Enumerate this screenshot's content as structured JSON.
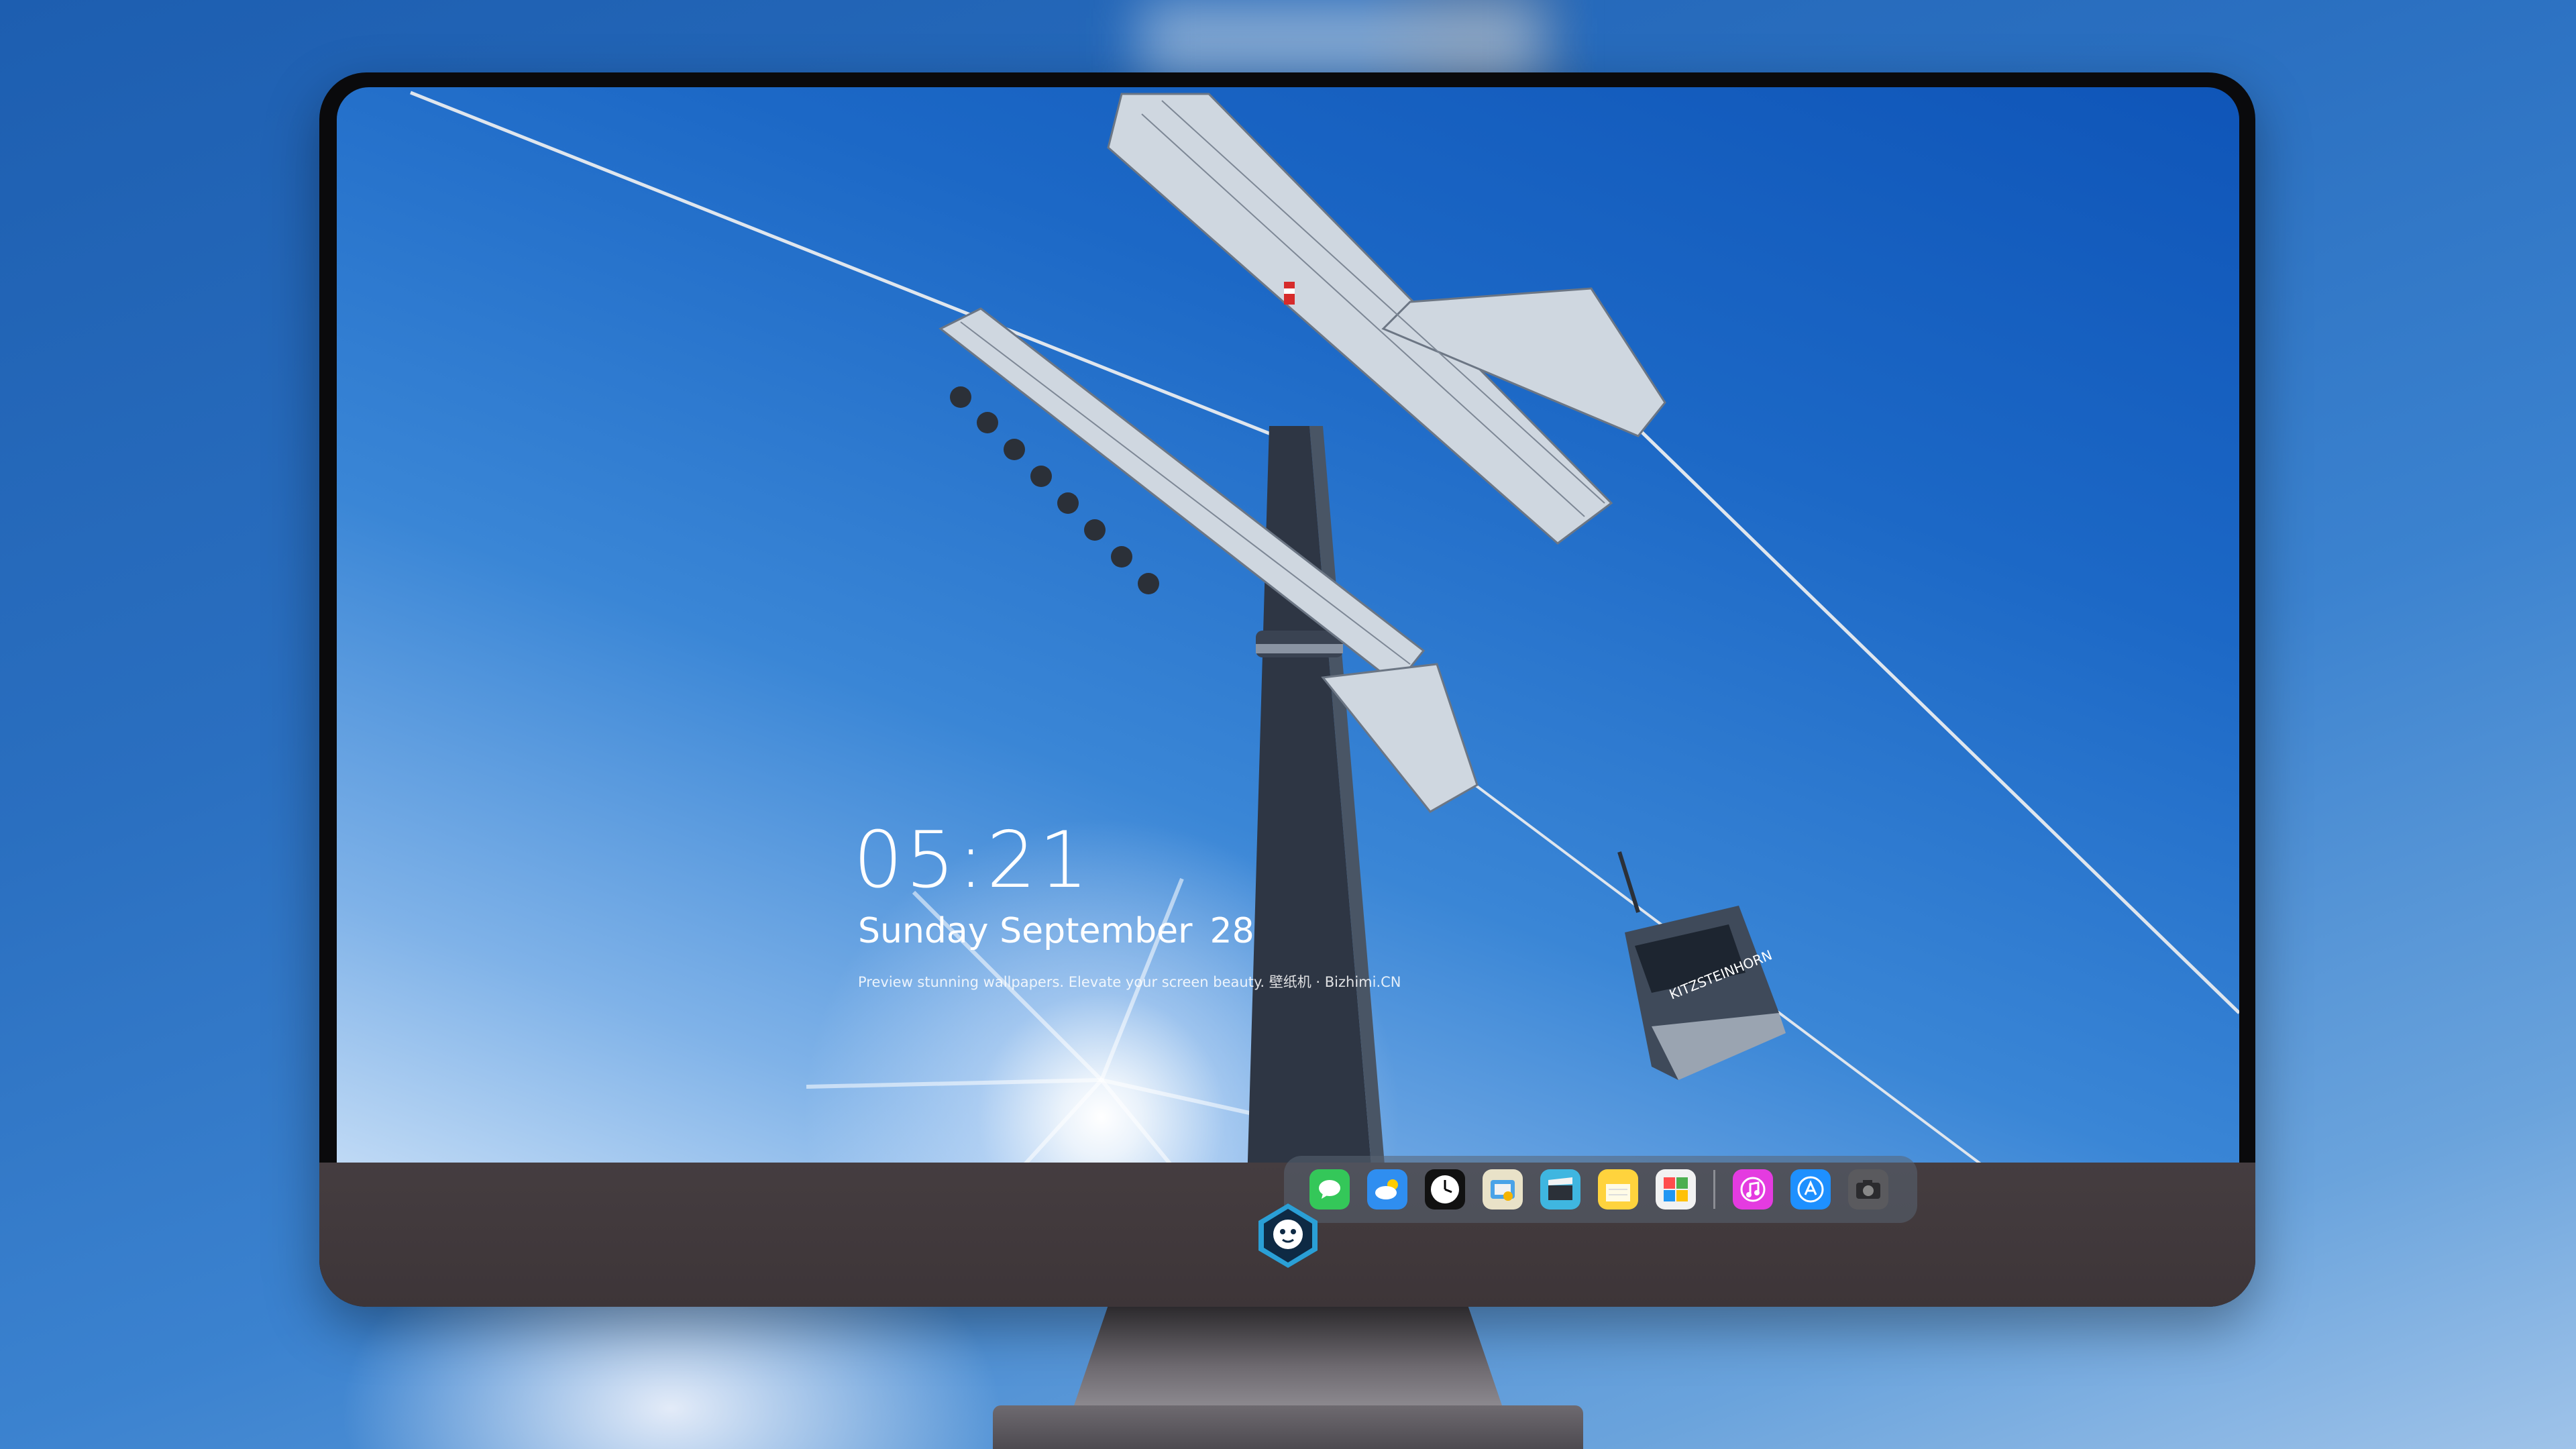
{
  "lockscreen": {
    "time": "05:21",
    "weekday": "Sunday",
    "month": "September",
    "day": "28",
    "tagline": "Preview stunning wallpapers. Elevate your screen beauty. 壁纸机 · Bizhimi.CN"
  },
  "dock": {
    "items": [
      {
        "name": "messages",
        "icon": "message-bubble-icon",
        "color": "#34c759"
      },
      {
        "name": "weather",
        "icon": "cloud-icon",
        "color": "#2f8ef0"
      },
      {
        "name": "clock",
        "icon": "clock-icon",
        "color": "#111111"
      },
      {
        "name": "preview",
        "icon": "photo-viewer-icon",
        "color": "#e9e2c8"
      },
      {
        "name": "clips",
        "icon": "clapperboard-icon",
        "color": "#3fb6e0"
      },
      {
        "name": "notes",
        "icon": "notes-icon",
        "color": "#ffd33d"
      },
      {
        "name": "photo-booth",
        "icon": "photos-grid-icon",
        "color": "#f2f2f2"
      },
      {
        "name": "music",
        "icon": "music-note-icon",
        "color": "#e43be0"
      },
      {
        "name": "app-store",
        "icon": "app-store-icon",
        "color": "#1e90ff"
      },
      {
        "name": "camera",
        "icon": "camera-icon",
        "color": "#5a5a5e"
      }
    ]
  },
  "gondola": {
    "label": "KITZSTEINHORN"
  },
  "colors": {
    "sky_top": "#0f55b8",
    "sky_bottom": "#cfe3f8",
    "chin": "#453d40"
  }
}
